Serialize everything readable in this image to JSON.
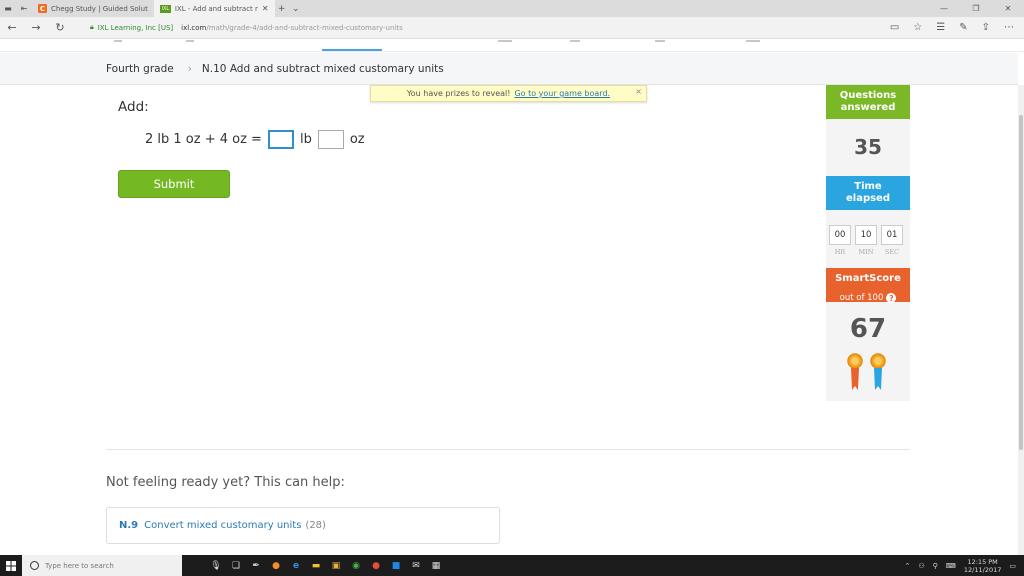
{
  "browser": {
    "tabs": [
      {
        "label": "Chegg Study | Guided Solut",
        "favicon": "C"
      },
      {
        "label": "IXL - Add and subtract r",
        "favicon": "IXL"
      }
    ],
    "site_identity": "IXL Learning, Inc [US]",
    "url_host": "ixl.com",
    "url_path": "/math/grade-4/add-and-subtract-mixed-customary-units"
  },
  "breadcrumb": {
    "grade": "Fourth grade",
    "skill": "N.10 Add and subtract mixed customary units"
  },
  "notification": {
    "text": "You have prizes to reveal!",
    "link": "Go to your game board.",
    "close": "×"
  },
  "question": {
    "prompt": "Add:",
    "expression": "2 lb 1 oz + 4 oz =",
    "unit1": "lb",
    "unit2": "oz",
    "submit_label": "Submit"
  },
  "sidebar": {
    "questions_answered_label_1": "Questions",
    "questions_answered_label_2": "answered",
    "questions_answered_value": "35",
    "time_elapsed_label_1": "Time",
    "time_elapsed_label_2": "elapsed",
    "time": {
      "hr": "00",
      "min": "10",
      "sec": "01"
    },
    "time_labels": {
      "hr": "HR",
      "min": "MIN",
      "sec": "SEC"
    },
    "smartscore_label": "SmartScore",
    "smartscore_sub": "out of 100",
    "smartscore_help": "?",
    "smartscore_value": "67"
  },
  "help": {
    "title": "Not feeling ready yet? This can help:",
    "link_code": "N.9",
    "link_name": "Convert mixed customary units",
    "link_count": "(28)"
  },
  "taskbar": {
    "search_placeholder": "Type here to search",
    "time": "12:15 PM",
    "date": "12/11/2017"
  },
  "colors": {
    "green": "#7ab828",
    "blue": "#2ba5e0",
    "orange": "#e8622d",
    "link": "#2a7ab8"
  }
}
